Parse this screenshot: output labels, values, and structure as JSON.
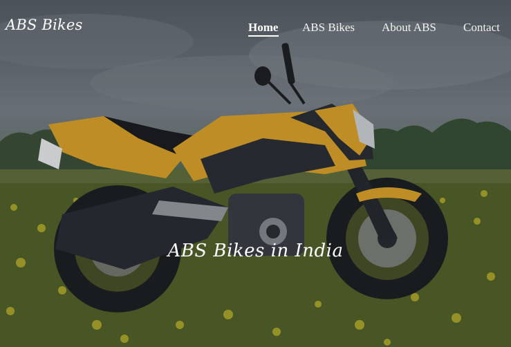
{
  "brand": {
    "name": "ABS Bikes"
  },
  "nav": {
    "items": [
      {
        "label": "Home",
        "active": true
      },
      {
        "label": "ABS Bikes",
        "active": false
      },
      {
        "label": "About ABS",
        "active": false
      },
      {
        "label": "Contact",
        "active": false
      }
    ]
  },
  "hero": {
    "caption": "ABS Bikes in India",
    "image_subject": "yellow-and-black sport motorcycle parked in a flowering field under a cloudy sky"
  },
  "colors": {
    "bike_yellow": "#e6a92a",
    "bike_dark": "#2b2e33",
    "text": "#ffffff"
  }
}
